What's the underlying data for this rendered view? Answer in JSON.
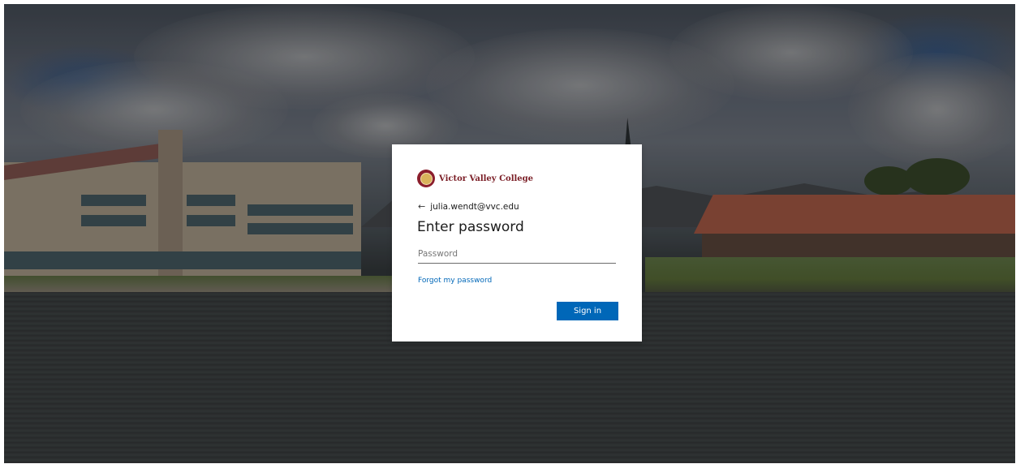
{
  "org": {
    "name": "Victor Valley College",
    "brand_color": "#7a1d25"
  },
  "signin": {
    "identity": "julia.wendt@vvc.edu",
    "back_icon": "back-arrow-icon",
    "title": "Enter password",
    "password_placeholder": "Password",
    "password_value": "",
    "forgot_link": "Forgot my password",
    "submit_label": "Sign in",
    "accent_color": "#0067b8"
  }
}
